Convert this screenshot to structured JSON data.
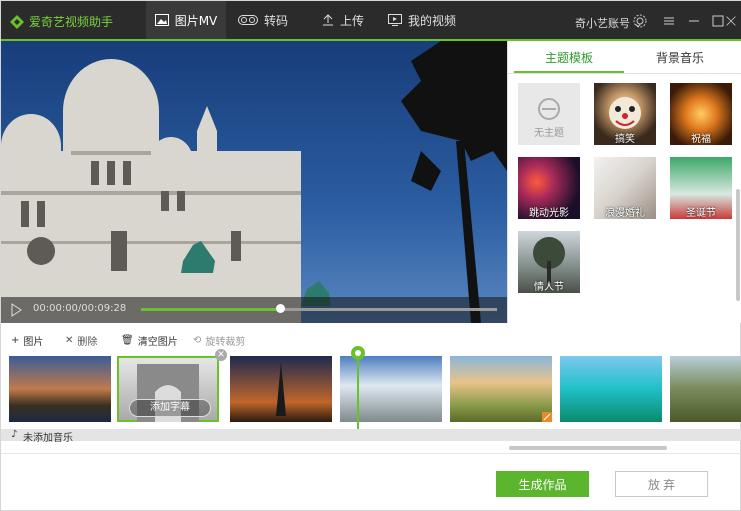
{
  "app": {
    "title": "爱奇艺视频助手"
  },
  "nav": {
    "items": [
      {
        "label": "图片MV",
        "active": true
      },
      {
        "label": "转码"
      },
      {
        "label": "上传"
      },
      {
        "label": "我的视频"
      }
    ]
  },
  "account": {
    "name": "奇小艺账号"
  },
  "player": {
    "timecode": "00:00:00/00:09:28",
    "progress": 0.39
  },
  "side": {
    "tabs": [
      {
        "label": "主题模板",
        "active": true
      },
      {
        "label": "背景音乐"
      }
    ],
    "templates": [
      {
        "label": "无主题"
      },
      {
        "label": "搞笑"
      },
      {
        "label": "祝福"
      },
      {
        "label": "跳动光影"
      },
      {
        "label": "浪漫婚礼"
      },
      {
        "label": "圣诞节"
      },
      {
        "label": "情人节"
      }
    ]
  },
  "toolbar": {
    "add": "图片",
    "delete": "删除",
    "clear": "清空图片",
    "rotate": "旋转裁剪"
  },
  "strip": {
    "subtitle_btn": "添加字幕"
  },
  "music": {
    "text": "未添加音乐"
  },
  "actions": {
    "generate": "生成作品",
    "discard": "放 弃"
  },
  "colors": {
    "accent": "#69c22d",
    "titlebar": "#2b2b2b"
  }
}
